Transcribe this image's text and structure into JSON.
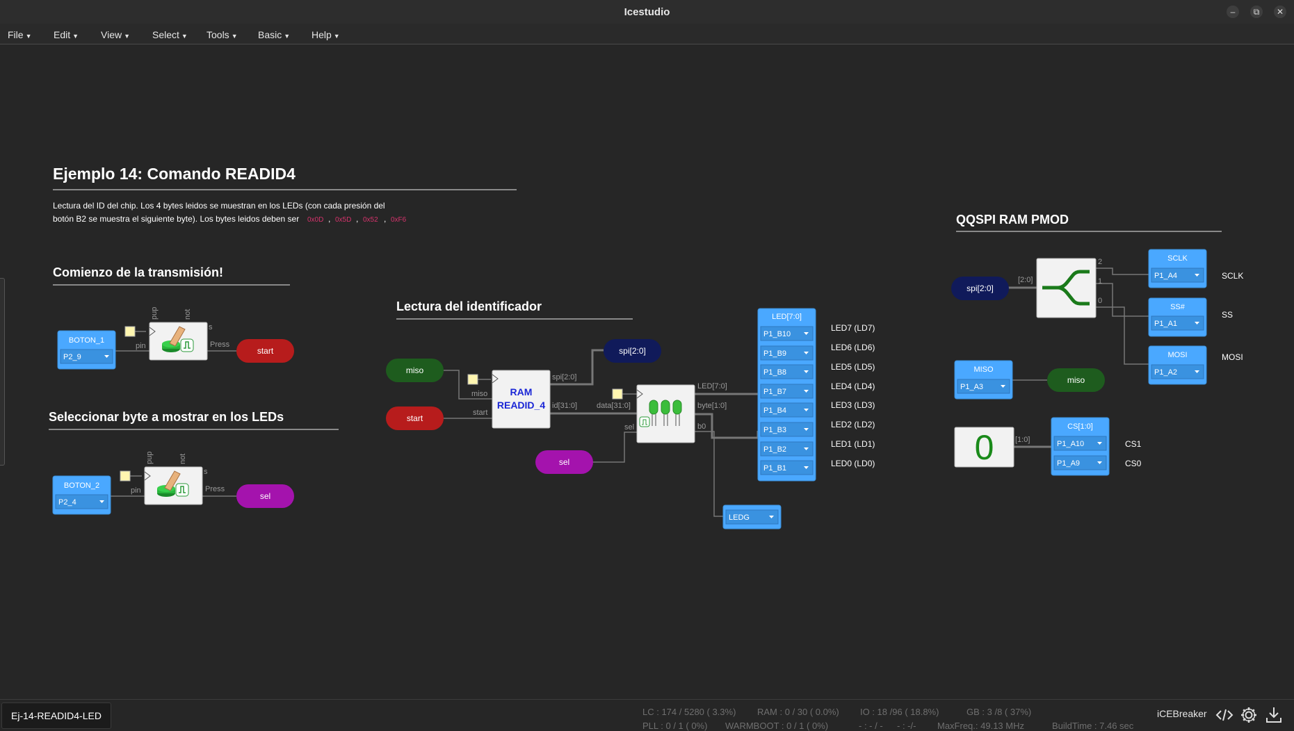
{
  "window": {
    "title": "Icestudio"
  },
  "menu": [
    {
      "label": "File"
    },
    {
      "label": "Edit"
    },
    {
      "label": "View"
    },
    {
      "label": "Select"
    },
    {
      "label": "Tools"
    },
    {
      "label": "Basic"
    },
    {
      "label": "Help"
    }
  ],
  "main": {
    "title": "Ejemplo 14: Comando READID4",
    "desc_line1": "Lectura del ID del chip. Los 4 bytes leidos se muestran en los LEDs (con cada presión del",
    "desc_line2": "botón B2 se muestra el siguiente byte). Los bytes leidos deben ser",
    "codes": [
      "0x0D",
      "0x5D",
      "0x52",
      "0xF6"
    ],
    "sep": ","
  },
  "sections": {
    "comienzo": "Comienzo de la transmisión!",
    "seleccionar": "Seleccionar byte a mostrar en los LEDs",
    "lectura": "Lectura del identificador",
    "qqspi": "QQSPI RAM PMOD"
  },
  "inputs": {
    "boton1": {
      "name": "BOTON_1",
      "pin": "P2_9"
    },
    "boton2": {
      "name": "BOTON_2",
      "pin": "P2_4"
    },
    "miso": {
      "name": "MISO",
      "pin": "P1_A3"
    }
  },
  "button_block": {
    "pup": "pup",
    "not": "not",
    "s": "s",
    "pin": "pin",
    "press": "Press"
  },
  "labels": {
    "start": "start",
    "sel": "sel",
    "miso": "miso",
    "spi_bus": "spi[2:0]",
    "spi_bus2": "spi[2:0]"
  },
  "ram_block": {
    "line1": "RAM",
    "line2": "READID_4",
    "in_miso": "miso",
    "in_start": "start",
    "out_spi": "spi[2:0]",
    "out_id": "id[31:0]"
  },
  "mux_block": {
    "in_data": "data[31:0]",
    "in_sel": "sel",
    "out_led": "LED[7:0]",
    "out_byte": "byte[1:0]",
    "out_b0": "b0"
  },
  "led_output": {
    "title": "LED[7:0]",
    "pins": [
      "P1_B10",
      "P1_B9",
      "P1_B8",
      "P1_B7",
      "P1_B4",
      "P1_B3",
      "P1_B2",
      "P1_B1"
    ],
    "names": [
      "LED7 (LD7)",
      "LED6 (LD6)",
      "LED5 (LD5)",
      "LED4 (LD4)",
      "LED3 (LD3)",
      "LED2 (LD2)",
      "LED1 (LD1)",
      "LED0 (LD0)"
    ]
  },
  "ledg": {
    "pin": "LEDG"
  },
  "splitter": {
    "bus": "[2:0]",
    "o2": "2",
    "o1": "1",
    "o0": "0"
  },
  "spi_outputs": [
    {
      "name": "SCLK",
      "pin": "P1_A4",
      "label": "SCLK"
    },
    {
      "name": "SS#",
      "pin": "P1_A1",
      "label": "SS"
    },
    {
      "name": "MOSI",
      "pin": "P1_A2",
      "label": "MOSI"
    }
  ],
  "constant": {
    "value": "0",
    "bus": "[1:0]"
  },
  "cs_output": {
    "name": "CS[1:0]",
    "pins": [
      "P1_A10",
      "P1_A9"
    ],
    "labels": [
      "CS1",
      "CS0"
    ]
  },
  "status": {
    "project": "Ej-14-READID4-LED",
    "lc": "LC : 174 / 5280 ( 3.3%)",
    "ram": "RAM : 0 / 30 ( 0.0%)",
    "io": "IO : 18 /96 ( 18.8%)",
    "gb": "GB : 3 /8 ( 37%)",
    "pll": "PLL : 0 / 1 ( 0%)",
    "warmboot": "WARMBOOT : 0 / 1 ( 0%)",
    "dash1": "- : - / -",
    "dash2": "- : -/-",
    "maxfreq": "MaxFreq.: 49.13 MHz",
    "buildtime": "BuildTime : 7.46 sec",
    "board": "iCEBreaker"
  },
  "colors": {
    "bg": "#262626",
    "accent": "#4aa8ff",
    "red": "#b71c1c",
    "green": "#1e5c1e",
    "purple": "#a413ad",
    "navy": "#101a5a",
    "wire": "#777777",
    "code": "#d6336c"
  },
  "icons": [
    "minimize-icon",
    "maximize-icon",
    "close-icon",
    "code-icon",
    "gear-icon",
    "download-icon"
  ]
}
